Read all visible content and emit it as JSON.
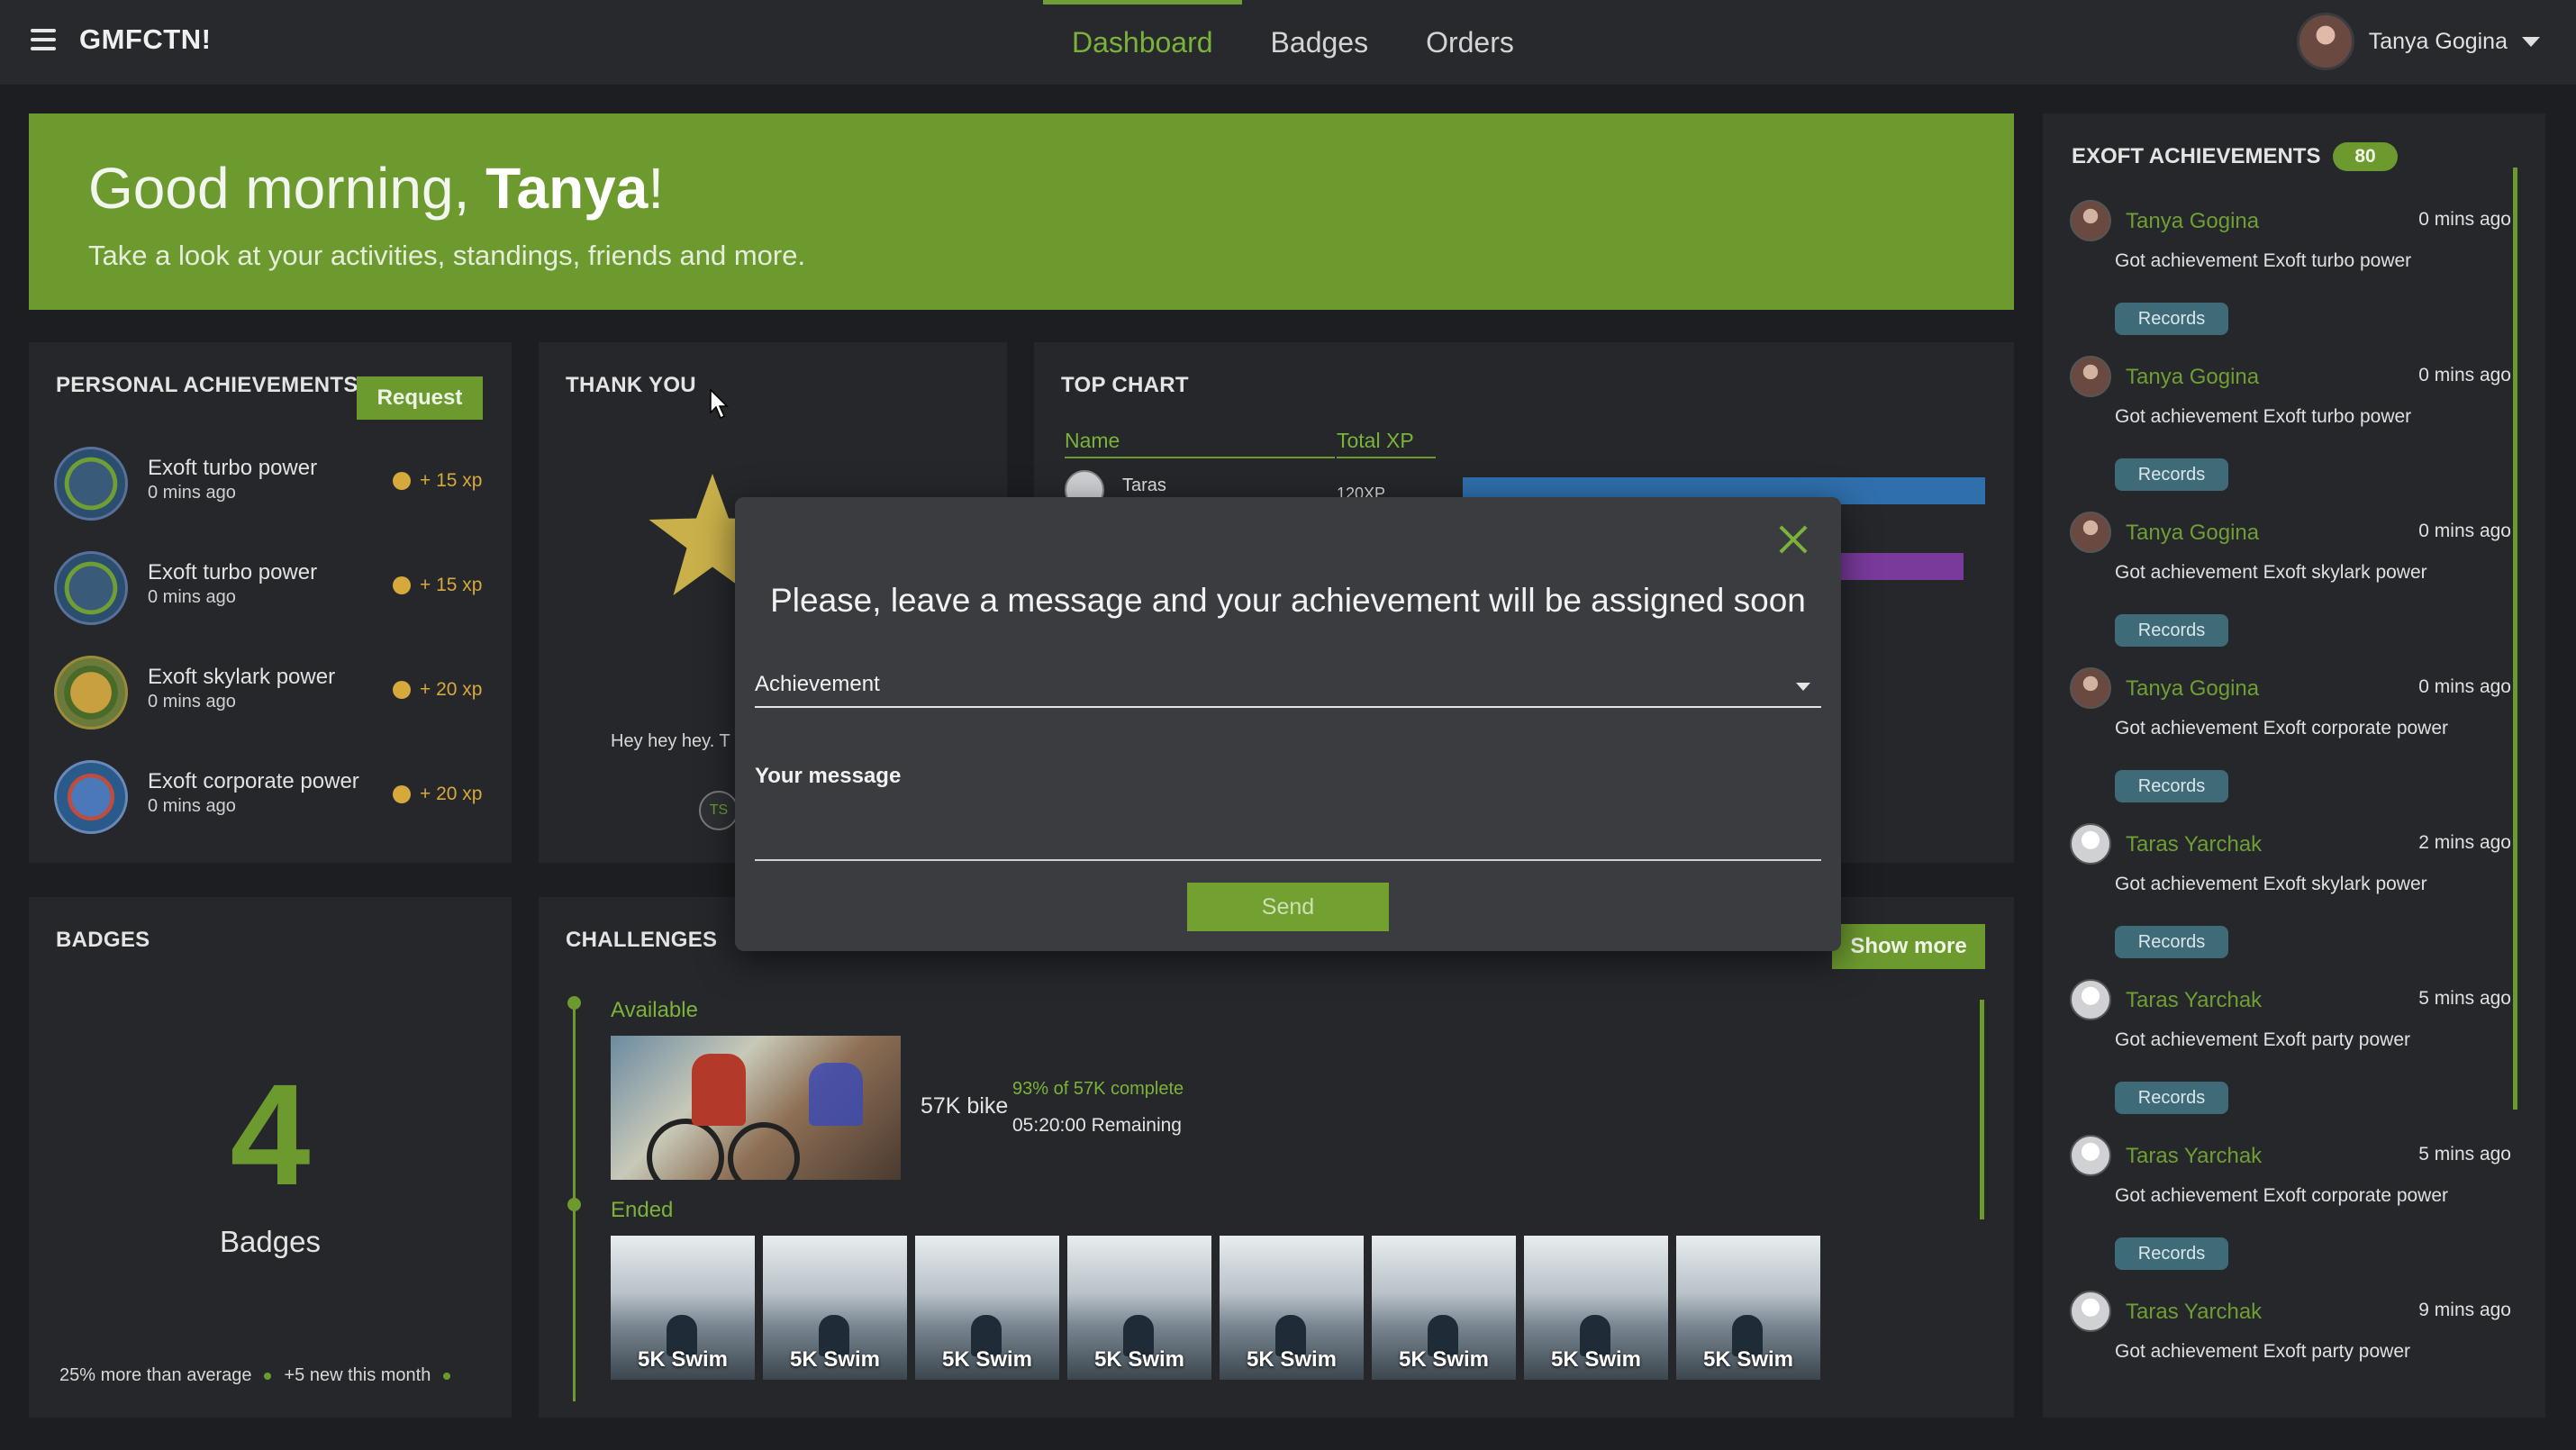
{
  "brand": "GMFCTN!",
  "nav": {
    "links": [
      "Dashboard",
      "Badges",
      "Orders"
    ],
    "active": "Dashboard"
  },
  "user": {
    "name": "Tanya Gogina"
  },
  "greeting": {
    "prefix": "Good morning, ",
    "name": "Tanya",
    "suffix": "!",
    "subtitle": "Take a look at your activities, standings, friends and more."
  },
  "personal": {
    "title": "PERSONAL ACHIEVEMENTS",
    "request_label": "Request",
    "items": [
      {
        "name": "Exoft turbo power",
        "time": "0 mins ago",
        "xp": "+ 15 xp"
      },
      {
        "name": "Exoft turbo power",
        "time": "0 mins ago",
        "xp": "+ 15 xp"
      },
      {
        "name": "Exoft skylark power",
        "time": "0 mins ago",
        "xp": "+ 20 xp"
      },
      {
        "name": "Exoft corporate power",
        "time": "0 mins ago",
        "xp": "+ 20 xp"
      }
    ]
  },
  "thankyou": {
    "title": "THANK YOU",
    "text": "Hey hey hey. T",
    "avatar_initials": "TS"
  },
  "topchart": {
    "title": "TOP CHART",
    "col_name": "Name",
    "col_xp": "Total XP",
    "rows": [
      {
        "name": "Taras",
        "xp": "120XP"
      }
    ],
    "bar_colors": [
      "#2f6fad",
      "#7a3a9c"
    ]
  },
  "badges": {
    "title": "BADGES",
    "count": "4",
    "label": "Badges",
    "foot_left": "25% more than average",
    "foot_right": "+5 new this month"
  },
  "challenges": {
    "title": "CHALLENGES",
    "show_more": "Show more",
    "available_label": "Available",
    "ended_label": "Ended",
    "available": {
      "name": "57K bike",
      "progress": "93% of 57K complete",
      "remaining": "05:20:00 Remaining"
    },
    "ended": [
      "5K Swim",
      "5K Swim",
      "5K Swim",
      "5K Swim",
      "5K Swim",
      "5K Swim",
      "5K Swim",
      "5K Swim"
    ]
  },
  "feed": {
    "title": "EXOFT ACHIEVEMENTS",
    "count": "80",
    "records_label": "Records",
    "items": [
      {
        "name": "Tanya Gogina",
        "time": "0 mins ago",
        "text": "Got achievement Exoft turbo power"
      },
      {
        "name": "Tanya Gogina",
        "time": "0 mins ago",
        "text": "Got achievement Exoft turbo power"
      },
      {
        "name": "Tanya Gogina",
        "time": "0 mins ago",
        "text": "Got achievement Exoft skylark power"
      },
      {
        "name": "Tanya Gogina",
        "time": "0 mins ago",
        "text": "Got achievement Exoft corporate power"
      },
      {
        "name": "Taras Yarchak",
        "time": "2 mins ago",
        "text": "Got achievement Exoft skylark power"
      },
      {
        "name": "Taras Yarchak",
        "time": "5 mins ago",
        "text": "Got achievement Exoft party power"
      },
      {
        "name": "Taras Yarchak",
        "time": "5 mins ago",
        "text": "Got achievement Exoft corporate power"
      },
      {
        "name": "Taras Yarchak",
        "time": "9 mins ago",
        "text": "Got achievement Exoft party power"
      }
    ]
  },
  "modal": {
    "title": "Please, leave a message and your achievement will be assigned soon",
    "select_value": "Achievement",
    "message_label": "Your message",
    "message_value": "",
    "send_label": "Send"
  },
  "colors": {
    "accent": "#6c9a2f",
    "background": "#1c1e21",
    "panel": "#25272b",
    "records": "#3f6a78",
    "xp": "#d6a93c"
  }
}
